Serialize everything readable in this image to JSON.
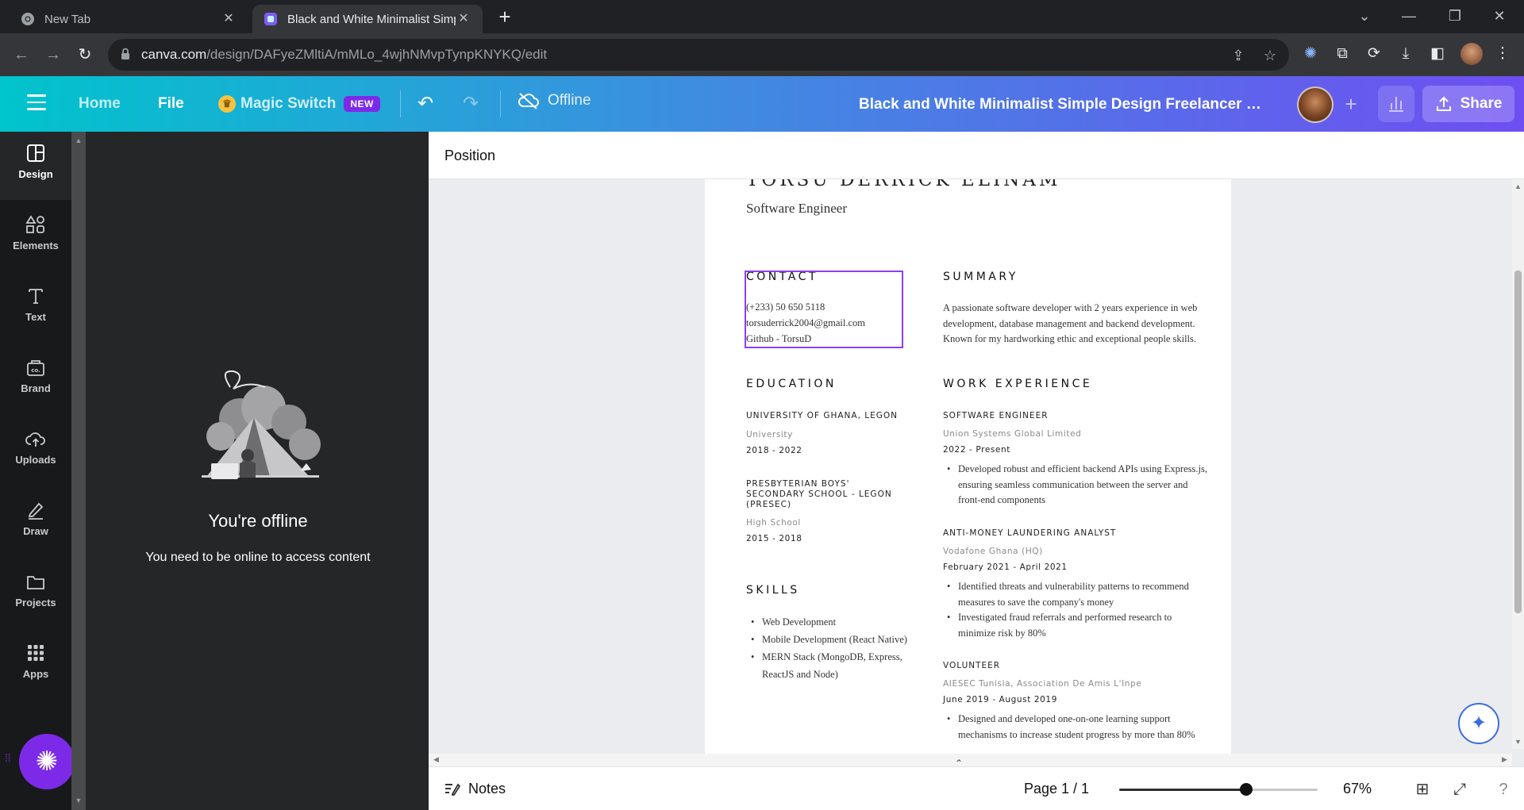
{
  "browser": {
    "tabs": [
      {
        "title": "New Tab",
        "active": false
      },
      {
        "title": "Black and White Minimalist Simp",
        "active": true
      }
    ],
    "url_host": "canva.com",
    "url_path": "/design/DAFyeZMltiA/mMLo_4wjhNMvpTynpKNYKQ/edit"
  },
  "header": {
    "home": "Home",
    "file": "File",
    "magic_switch": "Magic Switch",
    "new_badge": "NEW",
    "status": "Offline",
    "doc_title": "Black and White Minimalist Simple Design Freelancer Resu...",
    "share": "Share",
    "gradient": [
      "#00c4cc",
      "#3d8ee0",
      "#6f4ef2"
    ]
  },
  "rail": [
    {
      "label": "Design",
      "icon": "layout-icon"
    },
    {
      "label": "Elements",
      "icon": "shapes-icon"
    },
    {
      "label": "Text",
      "icon": "text-icon"
    },
    {
      "label": "Brand",
      "icon": "brand-icon"
    },
    {
      "label": "Uploads",
      "icon": "cloud-upload-icon"
    },
    {
      "label": "Draw",
      "icon": "pen-icon"
    },
    {
      "label": "Projects",
      "icon": "folder-icon"
    },
    {
      "label": "Apps",
      "icon": "apps-grid-icon"
    }
  ],
  "panel": {
    "title": "You're offline",
    "subtitle": "You need to be online to access content"
  },
  "position_bar": {
    "label": "Position"
  },
  "resume": {
    "name": "TORSU DERRICK ELINAM",
    "role": "Software Engineer",
    "contact": {
      "heading": "CONTACT",
      "phone": "(+233) 50 650 5118",
      "email": "torsuderrick2004@gmail.com",
      "github": "Github - TorsuD"
    },
    "summary": {
      "heading": "SUMMARY",
      "text": "A passionate software developer with 2 years experience in web development, database management and backend development. Known for my hardworking ethic and exceptional people skills."
    },
    "education": {
      "heading": "EDUCATION",
      "items": [
        {
          "school": "UNIVERSITY OF GHANA, LEGON",
          "level": "University",
          "dates": "2018 - 2022"
        },
        {
          "school": "PRESBYTERIAN BOYS' SECONDARY SCHOOL - LEGON (PRESEC)",
          "level": "High School",
          "dates": "2015 - 2018"
        }
      ]
    },
    "skills": {
      "heading": "SKILLS",
      "items": [
        "Web Development",
        "Mobile Development (React Native)",
        "MERN Stack (MongoDB, Express, ReactJS and Node)"
      ]
    },
    "work": {
      "heading": "WORK EXPERIENCE",
      "jobs": [
        {
          "title": "SOFTWARE ENGINEER",
          "company": "Union Systems Global Limited",
          "dates": "2022 - Present",
          "bullets": [
            "Developed robust and efficient backend APIs using Express.js, ensuring seamless communication between the server and front-end components"
          ]
        },
        {
          "title": "ANTI-MONEY LAUNDERING ANALYST",
          "company": "Vodafone Ghana (HQ)",
          "dates": "February 2021 - April 2021",
          "bullets": [
            "Identified threats and vulnerability patterns to recommend measures to save the company's money",
            "Investigated fraud referrals and performed research to minimize risk by 80%"
          ]
        },
        {
          "title": "VOLUNTEER",
          "company": "AIESEC Tunisia, Association De Amis L'Inpe",
          "dates": "June 2019 - August 2019",
          "bullets": [
            "Designed and developed one-on-one learning support mechanisms to increase student progress by more than 80%"
          ]
        }
      ]
    }
  },
  "footer": {
    "notes": "Notes",
    "page": "Page 1 / 1",
    "zoom": "67%",
    "zoom_level": 0.64
  },
  "colors": {
    "accent": "#7d2ae8",
    "selection": "#8b3dff",
    "rail_bg": "#18191b",
    "panel_bg": "#252627"
  }
}
